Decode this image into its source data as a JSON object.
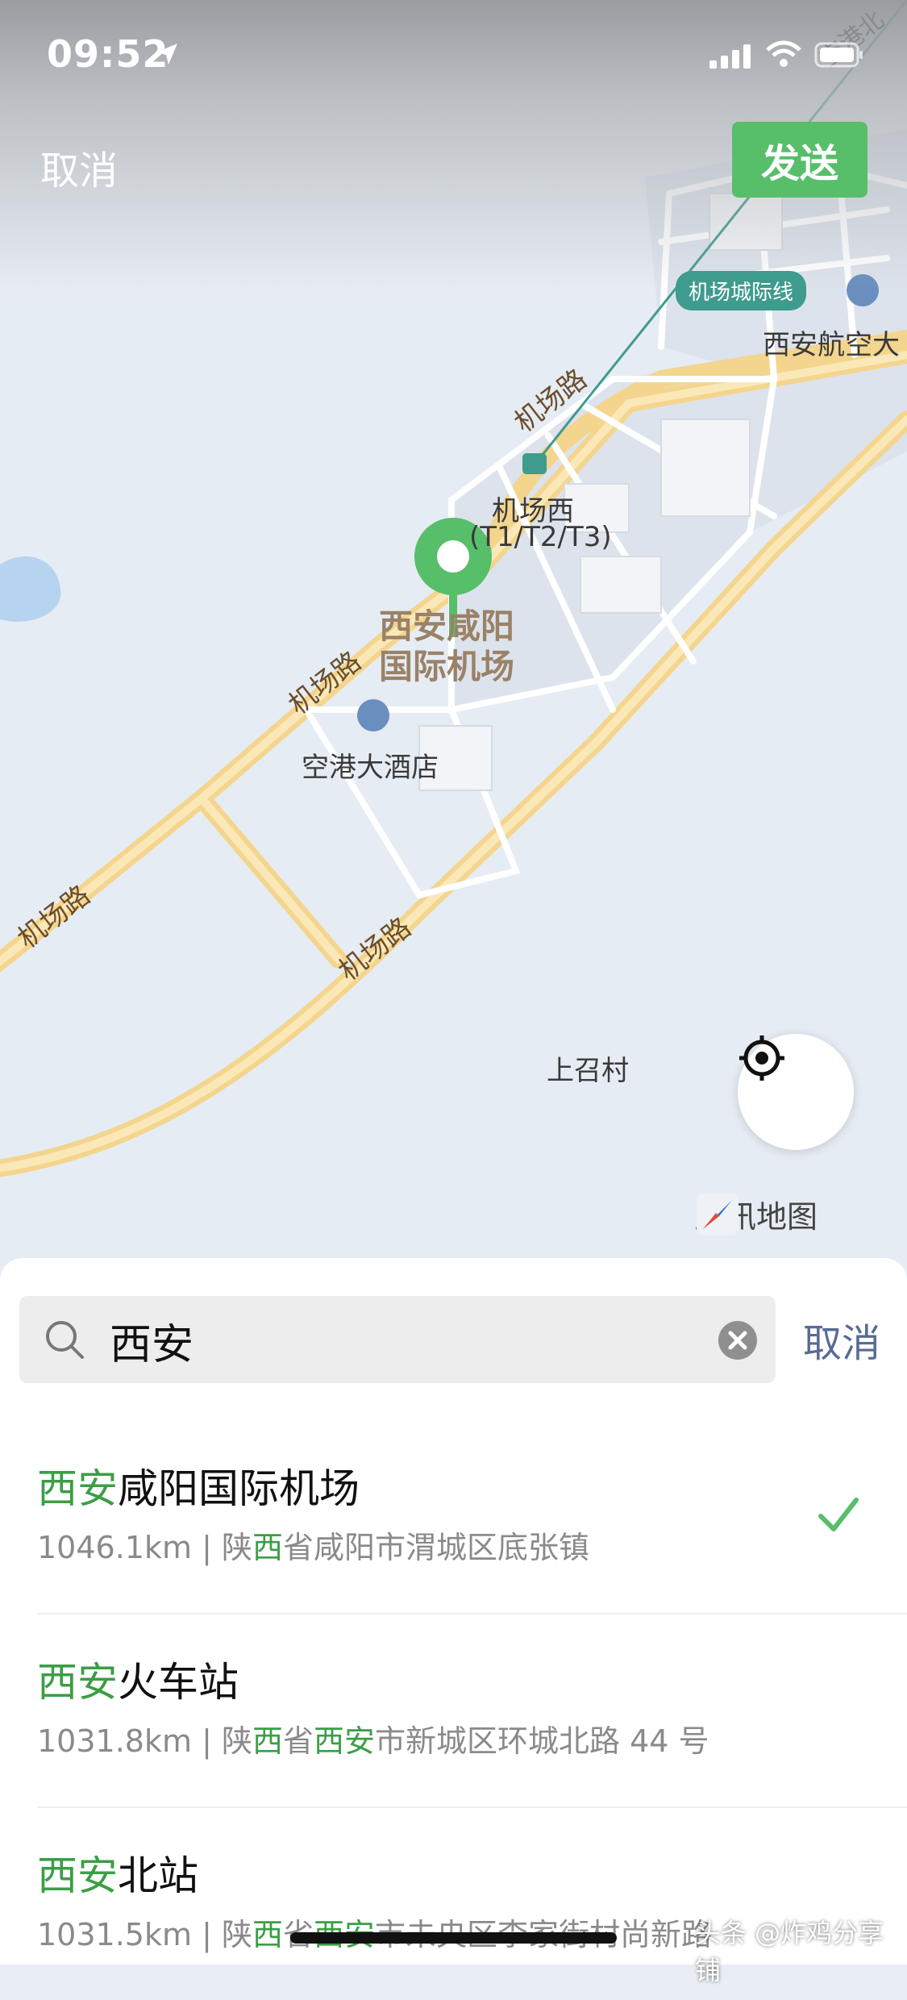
{
  "status_bar": {
    "time": "09:52"
  },
  "top_bar": {
    "cancel_label": "取消",
    "send_label": "发送"
  },
  "map": {
    "road_labels": [
      "机场路",
      "机场路",
      "机场路",
      "机场路"
    ],
    "metro_line": "机场城际线",
    "station_name": "机场西",
    "station_sub": "(T1/T2/T3)",
    "poi_selected": "西安咸阳\n国际机场",
    "hotel": "空港大酒店",
    "aviation": "西安航空大",
    "village": "上召村",
    "road_corner": "空港北",
    "provider": "腾讯地图",
    "colors": {
      "road": "#f8dc99",
      "water": "#b6d3f0",
      "pin": "#57be6a"
    }
  },
  "search": {
    "query": "西安",
    "cancel_label": "取消"
  },
  "results": [
    {
      "title_hl": "西安",
      "title_rest": "咸阳国际机场",
      "dist": "1046.1km | 陕",
      "a_hl": "西",
      "a_rest": "省咸阳市渭城区底张镇",
      "b_hl": "",
      "b_rest": "",
      "selected": true
    },
    {
      "title_hl": "西安",
      "title_rest": "火车站",
      "dist": "1031.8km | 陕",
      "a_hl": "西",
      "a_rest": "省",
      "b_hl": "西安",
      "b_rest": "市新城区环城北路 44 号",
      "selected": false
    },
    {
      "title_hl": "西安",
      "title_rest": "北站",
      "dist": "1031.5km | 陕",
      "a_hl": "西",
      "a_rest": "省",
      "b_hl": "西安",
      "b_rest": "市未央区李家街村尚新路",
      "selected": false
    }
  ],
  "watermark": "头条 @炸鸡分享铺"
}
